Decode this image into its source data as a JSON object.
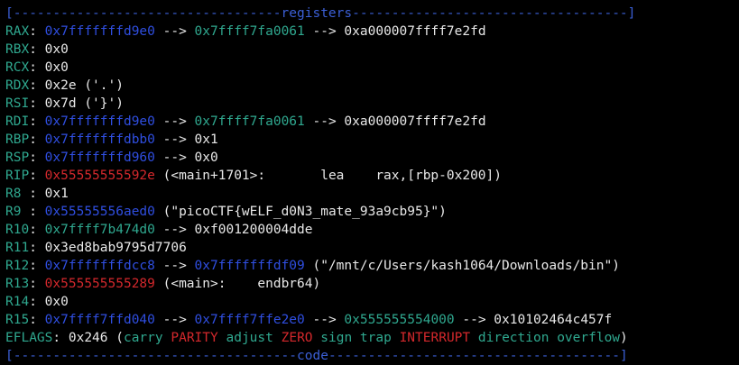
{
  "colors": {
    "background": "#000000",
    "separator": "#3b5fd6",
    "register_name": "#2fa88f",
    "code_pointer": "#d4282c",
    "heap_stack_pointer": "#2f4ee0",
    "data_pointer": "#2fa88f",
    "value": "#e8e8e8"
  },
  "header": {
    "title": "registers",
    "left": "[----------------------------------",
    "right": "-----------------------------------]"
  },
  "footer": {
    "title": "code",
    "left": "[------------------------------------",
    "right": "-------------------------------------]"
  },
  "registers": [
    {
      "name": "RAX",
      "sep": ": ",
      "parts": [
        {
          "t": "0x7fffffffd9e0",
          "c": "blue"
        },
        {
          "t": " --> ",
          "c": "white"
        },
        {
          "t": "0x7ffff7fa0061",
          "c": "green"
        },
        {
          "t": " --> ",
          "c": "white"
        },
        {
          "t": "0xa000007ffff7e2fd",
          "c": "white"
        }
      ]
    },
    {
      "name": "RBX",
      "sep": ": ",
      "parts": [
        {
          "t": "0x0",
          "c": "white"
        }
      ]
    },
    {
      "name": "RCX",
      "sep": ": ",
      "parts": [
        {
          "t": "0x0",
          "c": "white"
        }
      ]
    },
    {
      "name": "RDX",
      "sep": ": ",
      "parts": [
        {
          "t": "0x2e ('.')",
          "c": "white"
        }
      ]
    },
    {
      "name": "RSI",
      "sep": ": ",
      "parts": [
        {
          "t": "0x7d ('}')",
          "c": "white"
        }
      ]
    },
    {
      "name": "RDI",
      "sep": ": ",
      "parts": [
        {
          "t": "0x7fffffffd9e0",
          "c": "blue"
        },
        {
          "t": " --> ",
          "c": "white"
        },
        {
          "t": "0x7ffff7fa0061",
          "c": "green"
        },
        {
          "t": " --> ",
          "c": "white"
        },
        {
          "t": "0xa000007ffff7e2fd",
          "c": "white"
        }
      ]
    },
    {
      "name": "RBP",
      "sep": ": ",
      "parts": [
        {
          "t": "0x7fffffffdbb0",
          "c": "blue"
        },
        {
          "t": " --> ",
          "c": "white"
        },
        {
          "t": "0x1",
          "c": "white"
        }
      ]
    },
    {
      "name": "RSP",
      "sep": ": ",
      "parts": [
        {
          "t": "0x7fffffffd960",
          "c": "blue"
        },
        {
          "t": " --> ",
          "c": "white"
        },
        {
          "t": "0x0",
          "c": "white"
        }
      ]
    },
    {
      "name": "RIP",
      "sep": ": ",
      "parts": [
        {
          "t": "0x55555555592e",
          "c": "red"
        },
        {
          "t": " (<main+1701>:       lea    rax,[rbp-0x200])",
          "c": "white"
        }
      ]
    },
    {
      "name": "R8",
      "sep": " : ",
      "parts": [
        {
          "t": "0x1",
          "c": "white"
        }
      ]
    },
    {
      "name": "R9",
      "sep": " : ",
      "parts": [
        {
          "t": "0x55555556aed0",
          "c": "blue"
        },
        {
          "t": " (\"picoCTF{wELF_d0N3_mate_93a9cb95}\")",
          "c": "white"
        }
      ]
    },
    {
      "name": "R10",
      "sep": ": ",
      "parts": [
        {
          "t": "0x7ffff7b474d0",
          "c": "green"
        },
        {
          "t": " --> ",
          "c": "white"
        },
        {
          "t": "0xf001200004dde",
          "c": "white"
        }
      ]
    },
    {
      "name": "R11",
      "sep": ": ",
      "parts": [
        {
          "t": "0x3ed8bab9795d7706",
          "c": "white"
        }
      ]
    },
    {
      "name": "R12",
      "sep": ": ",
      "parts": [
        {
          "t": "0x7fffffffdcc8",
          "c": "blue"
        },
        {
          "t": " --> ",
          "c": "white"
        },
        {
          "t": "0x7fffffffdf09",
          "c": "blue"
        },
        {
          "t": " (\"/mnt/c/Users/kash1064/Downloads/bin\")",
          "c": "white"
        }
      ]
    },
    {
      "name": "R13",
      "sep": ": ",
      "parts": [
        {
          "t": "0x555555555289",
          "c": "red"
        },
        {
          "t": " (<main>:    endbr64)",
          "c": "white"
        }
      ]
    },
    {
      "name": "R14",
      "sep": ": ",
      "parts": [
        {
          "t": "0x0",
          "c": "white"
        }
      ]
    },
    {
      "name": "R15",
      "sep": ": ",
      "parts": [
        {
          "t": "0x7ffff7ffd040",
          "c": "blue"
        },
        {
          "t": " --> ",
          "c": "white"
        },
        {
          "t": "0x7ffff7ffe2e0",
          "c": "blue"
        },
        {
          "t": " --> ",
          "c": "white"
        },
        {
          "t": "0x555555554000",
          "c": "green"
        },
        {
          "t": " --> ",
          "c": "white"
        },
        {
          "t": "0x10102464c457f",
          "c": "white"
        }
      ]
    },
    {
      "name": "EFLAGS",
      "sep": ": ",
      "parts": [
        {
          "t": "0x246 (",
          "c": "white"
        },
        {
          "t": "carry",
          "c": "green"
        },
        {
          "t": " ",
          "c": "white"
        },
        {
          "t": "PARITY",
          "c": "red"
        },
        {
          "t": " ",
          "c": "white"
        },
        {
          "t": "adjust",
          "c": "green"
        },
        {
          "t": " ",
          "c": "white"
        },
        {
          "t": "ZERO",
          "c": "red"
        },
        {
          "t": " ",
          "c": "white"
        },
        {
          "t": "sign",
          "c": "green"
        },
        {
          "t": " ",
          "c": "white"
        },
        {
          "t": "trap",
          "c": "green"
        },
        {
          "t": " ",
          "c": "white"
        },
        {
          "t": "INTERRUPT",
          "c": "red"
        },
        {
          "t": " ",
          "c": "white"
        },
        {
          "t": "direction",
          "c": "green"
        },
        {
          "t": " ",
          "c": "white"
        },
        {
          "t": "overflow",
          "c": "green"
        },
        {
          "t": ")",
          "c": "white"
        }
      ]
    }
  ]
}
